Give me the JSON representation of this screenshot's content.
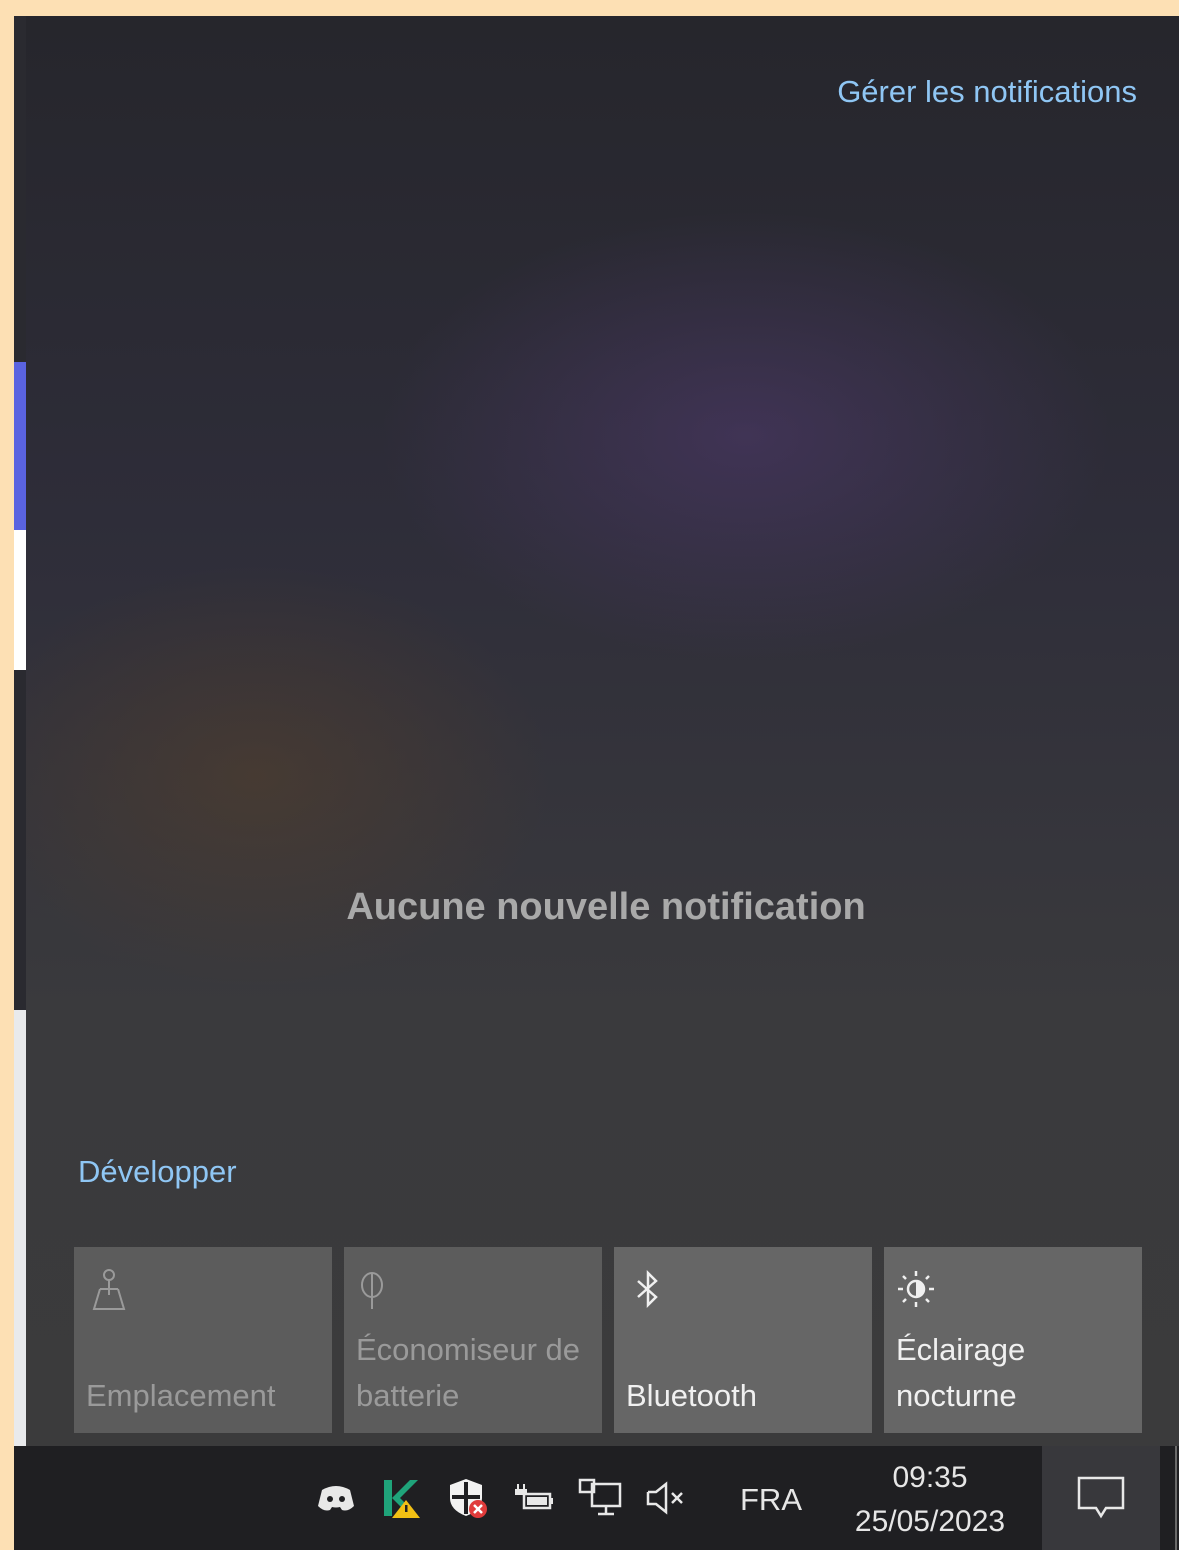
{
  "action_center": {
    "manage_link": "Gérer les notifications",
    "empty_message": "Aucune nouvelle notification",
    "expand_link": "Développer",
    "tiles": [
      {
        "label": "Emplacement",
        "icon": "location-icon",
        "state": "disabled"
      },
      {
        "label": "Économiseur de batterie",
        "icon": "battery-saver-icon",
        "state": "disabled"
      },
      {
        "label": "Bluetooth",
        "icon": "bluetooth-icon",
        "state": "off"
      },
      {
        "label": "Éclairage nocturne",
        "icon": "night-light-icon",
        "state": "off"
      }
    ]
  },
  "taskbar": {
    "tray_icons": [
      "discord-icon",
      "kaspersky-warning-icon",
      "defender-error-icon",
      "power-battery-icon",
      "network-icon",
      "volume-muted-icon"
    ],
    "language": "FRA",
    "time": "09:35",
    "date": "25/05/2023",
    "notification_button_icon": "action-center-icon"
  },
  "colors": {
    "link": "#8fc6f4",
    "tile_disabled": "#5c5c5c",
    "tile_enabled": "#666666",
    "taskbar": "#1f1f22",
    "frame": "#fde0b4"
  }
}
